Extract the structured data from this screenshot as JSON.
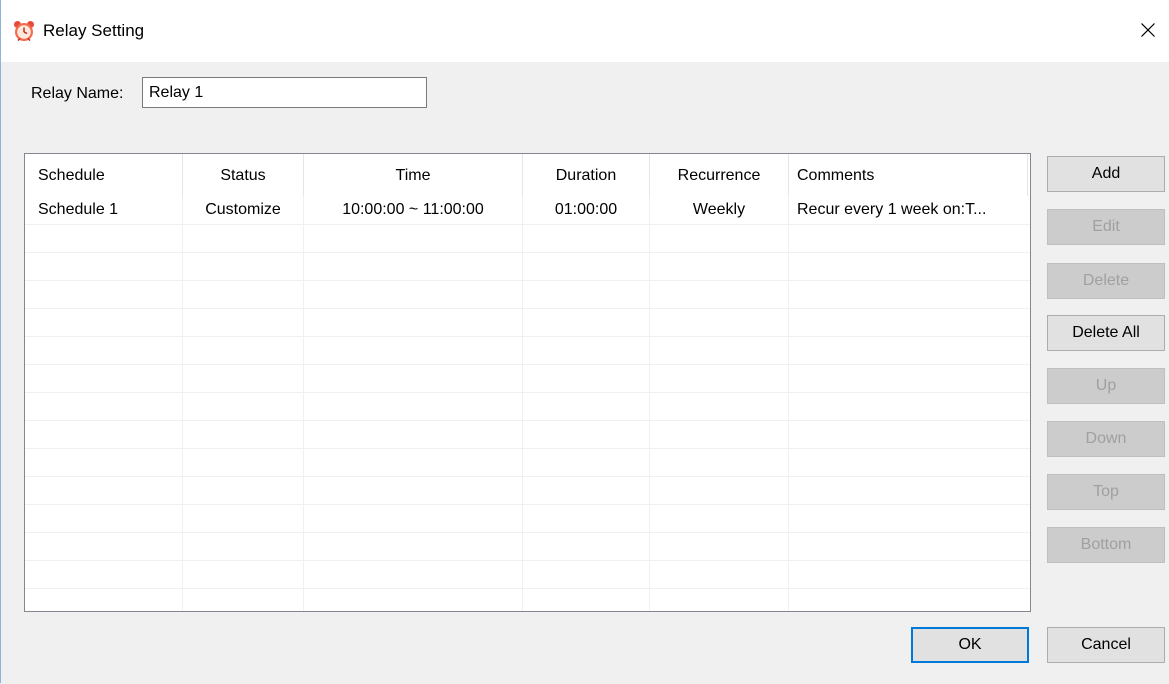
{
  "window": {
    "title": "Relay Setting",
    "close_glyph": "✕",
    "icon": "alarm-clock-icon"
  },
  "relay": {
    "label": "Relay Name:",
    "value": "Relay 1"
  },
  "table": {
    "columns": [
      "Schedule",
      "Status",
      "Time",
      "Duration",
      "Recurrence",
      "Comments"
    ],
    "rows": [
      [
        "Schedule 1",
        "Customize",
        "10:00:00 ~ 11:00:00",
        "01:00:00",
        "Weekly",
        "Recur every 1 week on:T..."
      ]
    ]
  },
  "side_buttons": [
    {
      "label": "Add",
      "enabled": true
    },
    {
      "label": "Edit",
      "enabled": false
    },
    {
      "label": "Delete",
      "enabled": false
    },
    {
      "label": "Delete All",
      "enabled": true
    },
    {
      "label": "Up",
      "enabled": false
    },
    {
      "label": "Down",
      "enabled": false
    },
    {
      "label": "Top",
      "enabled": false
    },
    {
      "label": "Bottom",
      "enabled": false
    }
  ],
  "footer": {
    "ok_label": "OK",
    "cancel_label": "Cancel"
  },
  "colors": {
    "accent": "#0078d7",
    "window_border": "#8fb3d9",
    "disabled_text": "#a0a0a0"
  }
}
